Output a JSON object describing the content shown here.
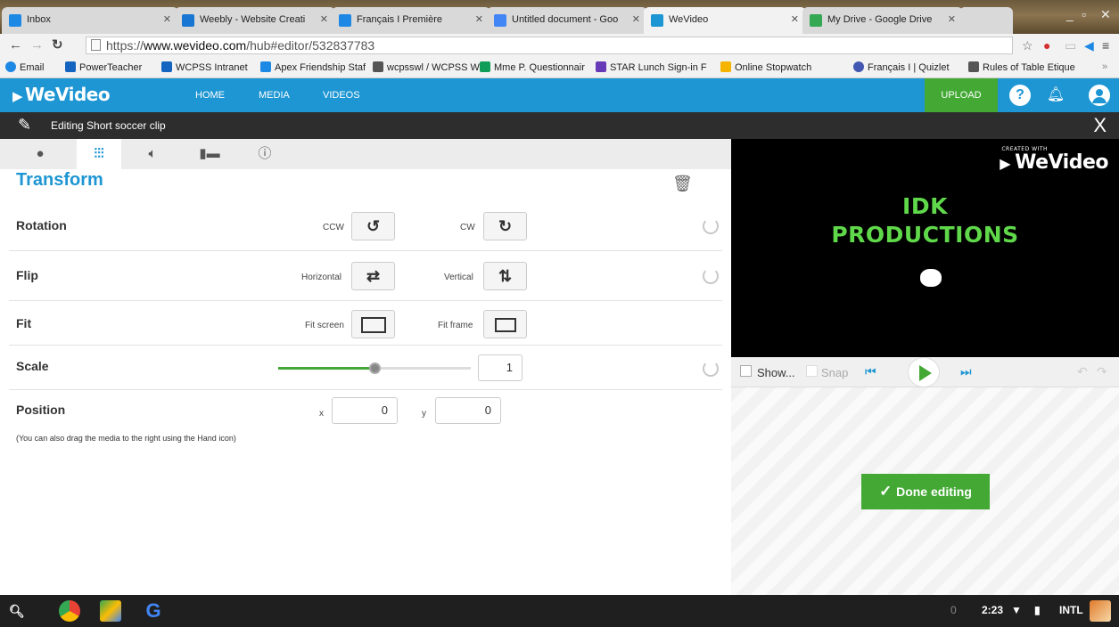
{
  "browser": {
    "tabs": [
      {
        "title": "Inbox",
        "color": "#1e88e5"
      },
      {
        "title": "Weebly - Website Creati",
        "color": "#1976d2"
      },
      {
        "title": "Français I Première",
        "color": "#1e88e5"
      },
      {
        "title": "Untitled document - Goo",
        "color": "#4285f4"
      },
      {
        "title": "WeVideo",
        "color": "#1d96d3"
      },
      {
        "title": "My Drive - Google Drive",
        "color": "#34a853"
      }
    ],
    "url_prefix": "https://",
    "url_domain": "www.wevideo.com",
    "url_path": "/hub#editor/532837783",
    "bookmarks": [
      {
        "label": "Email",
        "color": "#1e88e5"
      },
      {
        "label": "PowerTeacher",
        "color": "#1565c0"
      },
      {
        "label": "WCPSS Intranet",
        "color": "#1565c0"
      },
      {
        "label": "Apex Friendship Staf",
        "color": "#1e88e5"
      },
      {
        "label": "wcpsswl / WCPSS W",
        "color": "#555555"
      },
      {
        "label": "Mme P. Questionnair",
        "color": "#0f9d58"
      },
      {
        "label": "STAR Lunch Sign-in F",
        "color": "#673ab7"
      },
      {
        "label": "Online Stopwatch",
        "color": "#f4b400"
      },
      {
        "label": "Français I | Quizlet",
        "color": "#4257b2"
      },
      {
        "label": "Rules of Table Etique",
        "color": "#555555"
      }
    ]
  },
  "app": {
    "logo": "WeVideo",
    "nav": [
      "HOME",
      "MEDIA",
      "VIDEOS"
    ],
    "upload_label": "UPLOAD",
    "help_glyph": "?",
    "editing_title": "Editing Short soccer clip",
    "close_glyph": "X",
    "accent": "#1d96d3",
    "green": "#43a934"
  },
  "transform": {
    "section_title": "Transform",
    "rotation": {
      "label": "Rotation",
      "ccw": "CCW",
      "cw": "CW"
    },
    "flip": {
      "label": "Flip",
      "horizontal": "Horizontal",
      "vertical": "Vertical"
    },
    "fit": {
      "label": "Fit",
      "screen": "Fit screen",
      "frame": "Fit frame"
    },
    "scale": {
      "label": "Scale",
      "value": "1",
      "slider_fraction": 0.5
    },
    "position": {
      "label": "Position",
      "x_label": "x",
      "y_label": "y",
      "x": "0",
      "y": "0",
      "hint": "(You can also drag the media to the right using the Hand icon)"
    }
  },
  "preview": {
    "watermark_small": "CREATED WITH",
    "watermark": "WeVideo",
    "title_line1": "IDK",
    "title_line2": "PRODUCTIONS",
    "show_label": "Show...",
    "snap_label": "Snap",
    "done_label": "Done editing"
  },
  "shelf": {
    "notifications": "0",
    "time": "2:23",
    "input_method": "INTL"
  }
}
